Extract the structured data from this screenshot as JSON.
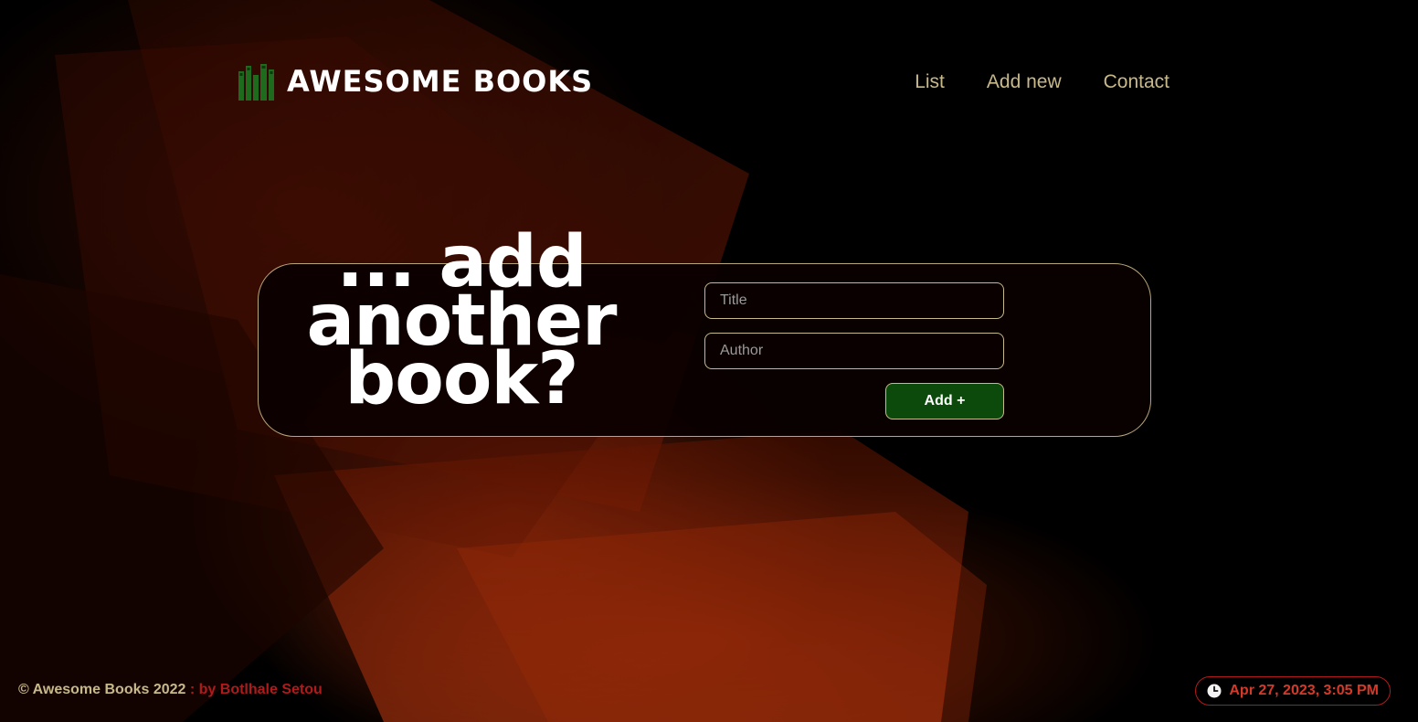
{
  "header": {
    "logo_text": "Awesome Books",
    "nav": [
      {
        "label": "List"
      },
      {
        "label": "Add new"
      },
      {
        "label": "Contact"
      }
    ]
  },
  "form": {
    "headline": "... add another book?",
    "title_placeholder": "Title",
    "author_placeholder": "Author",
    "add_label": "Add +"
  },
  "footer": {
    "copyright": "© Awesome Books 2022",
    "author_credit": " : by Botlhale Setou",
    "datetime": "Apr 27, 2023, 3:05 PM"
  },
  "colors": {
    "nav_text": "#c8b98a",
    "add_button": "#0b4a0b",
    "credit_red": "#b11a1a",
    "logo_icon_green": "#1e6b1e"
  },
  "icons": {
    "logo": "books-icon",
    "datetime": "clock-icon"
  }
}
